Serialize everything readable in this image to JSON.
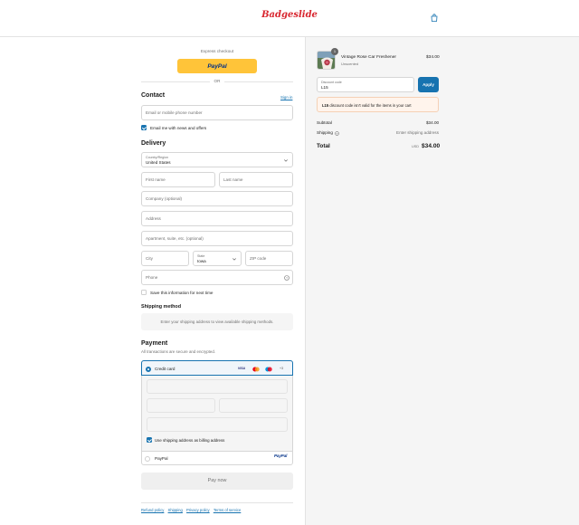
{
  "header": {
    "logo": "Badgeslide"
  },
  "express": {
    "title": "Express checkout",
    "paypal": "PayPal",
    "or": "OR"
  },
  "contact": {
    "heading": "Contact",
    "sign_in": "Sign in",
    "email_placeholder": "Email or mobile phone number",
    "news_label": "Email me with news and offers",
    "news_checked": true
  },
  "delivery": {
    "heading": "Delivery",
    "country_label": "Country/Region",
    "country_value": "United States",
    "first_name": "First name",
    "last_name": "Last name",
    "company": "Company (optional)",
    "address": "Address",
    "apartment": "Apartment, suite, etc. (optional)",
    "city": "City",
    "state_label": "State",
    "state_value": "Iowa",
    "zip": "ZIP code",
    "phone": "Phone",
    "save_label": "Save this information for next time"
  },
  "shipping": {
    "heading": "Shipping method",
    "message": "Enter your shipping address to view available shipping methods."
  },
  "payment": {
    "heading": "Payment",
    "subtitle": "All transactions are secure and encrypted.",
    "credit_card": "Credit card",
    "card_brands": [
      "VISA",
      "+3"
    ],
    "billing_label": "Use shipping address as billing address",
    "paypal_option": "PayPal",
    "paypal_logo": "PayPal",
    "pay_now": "Pay now"
  },
  "footer": {
    "links": [
      "Refund policy",
      "Shipping",
      "Privacy policy",
      "Terms of service"
    ]
  },
  "summary": {
    "item": {
      "name": "Vintage Rose Car Freshener",
      "variant": "Unscented",
      "price": "$34.00",
      "qty": "1"
    },
    "discount": {
      "label": "Discount code",
      "value": "L15",
      "apply": "Apply"
    },
    "error": {
      "code": "L15",
      "text": " discount code isn't valid for the items in your cart"
    },
    "subtotal_label": "Subtotal",
    "subtotal_value": "$34.00",
    "shipping_label": "Shipping",
    "shipping_value": "Enter shipping address",
    "total_label": "Total",
    "currency": "USD",
    "total_value": "$34.00"
  },
  "colors": {
    "accent": "#1773b0",
    "paypal_yellow": "#ffc439",
    "brand": "#d8262f",
    "error_bg": "#fff4ec"
  }
}
